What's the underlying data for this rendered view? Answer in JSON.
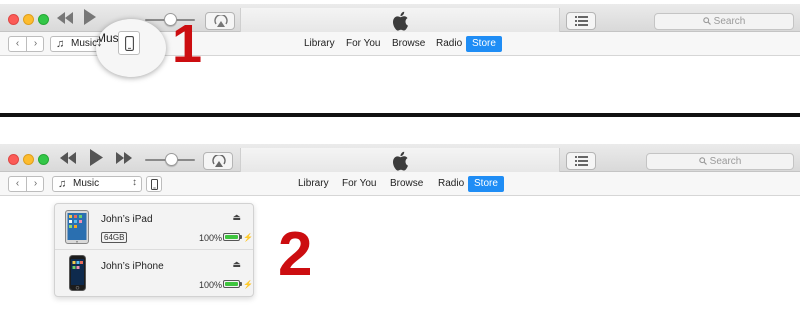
{
  "window_controls": {
    "close": "close",
    "minimize": "minimize",
    "zoom": "zoom",
    "colors": {
      "close": "#fc5b57",
      "minimize": "#fdbc2e",
      "zoom": "#33c748"
    }
  },
  "player": {
    "rewind_icon": "rewind-icon",
    "play_icon": "play-icon",
    "forward_icon": "fast-forward-icon",
    "volume_level": 0.5,
    "airplay_icon": "airplay-icon"
  },
  "lcd": {
    "logo_icon": "apple-logo-icon"
  },
  "toolbar": {
    "list_icon": "list-icon",
    "search_placeholder": "Search"
  },
  "nav": {
    "back_icon": "chevron-left-icon",
    "forward_icon": "chevron-right-icon",
    "media_select_label": "Music",
    "device_icon": "iphone-icon",
    "tabs": [
      {
        "label": "Library",
        "active": false
      },
      {
        "label": "For You",
        "active": false
      },
      {
        "label": "Browse",
        "active": false
      },
      {
        "label": "Radio",
        "active": false
      },
      {
        "label": "Store",
        "active": true
      }
    ],
    "accent": "#1f8df5"
  },
  "steps": {
    "step1": "1",
    "step2": "2",
    "color": "#cc0d10"
  },
  "devices": [
    {
      "name": "John’s iPad",
      "capacity": "64GB",
      "battery": "100%",
      "battery_level": 1.0,
      "eject_icon": "eject-icon",
      "charging_icon": "lightning-icon"
    },
    {
      "name": "John’s iPhone",
      "battery": "100%",
      "battery_level": 1.0,
      "eject_icon": "eject-icon",
      "charging_icon": "lightning-icon"
    }
  ]
}
